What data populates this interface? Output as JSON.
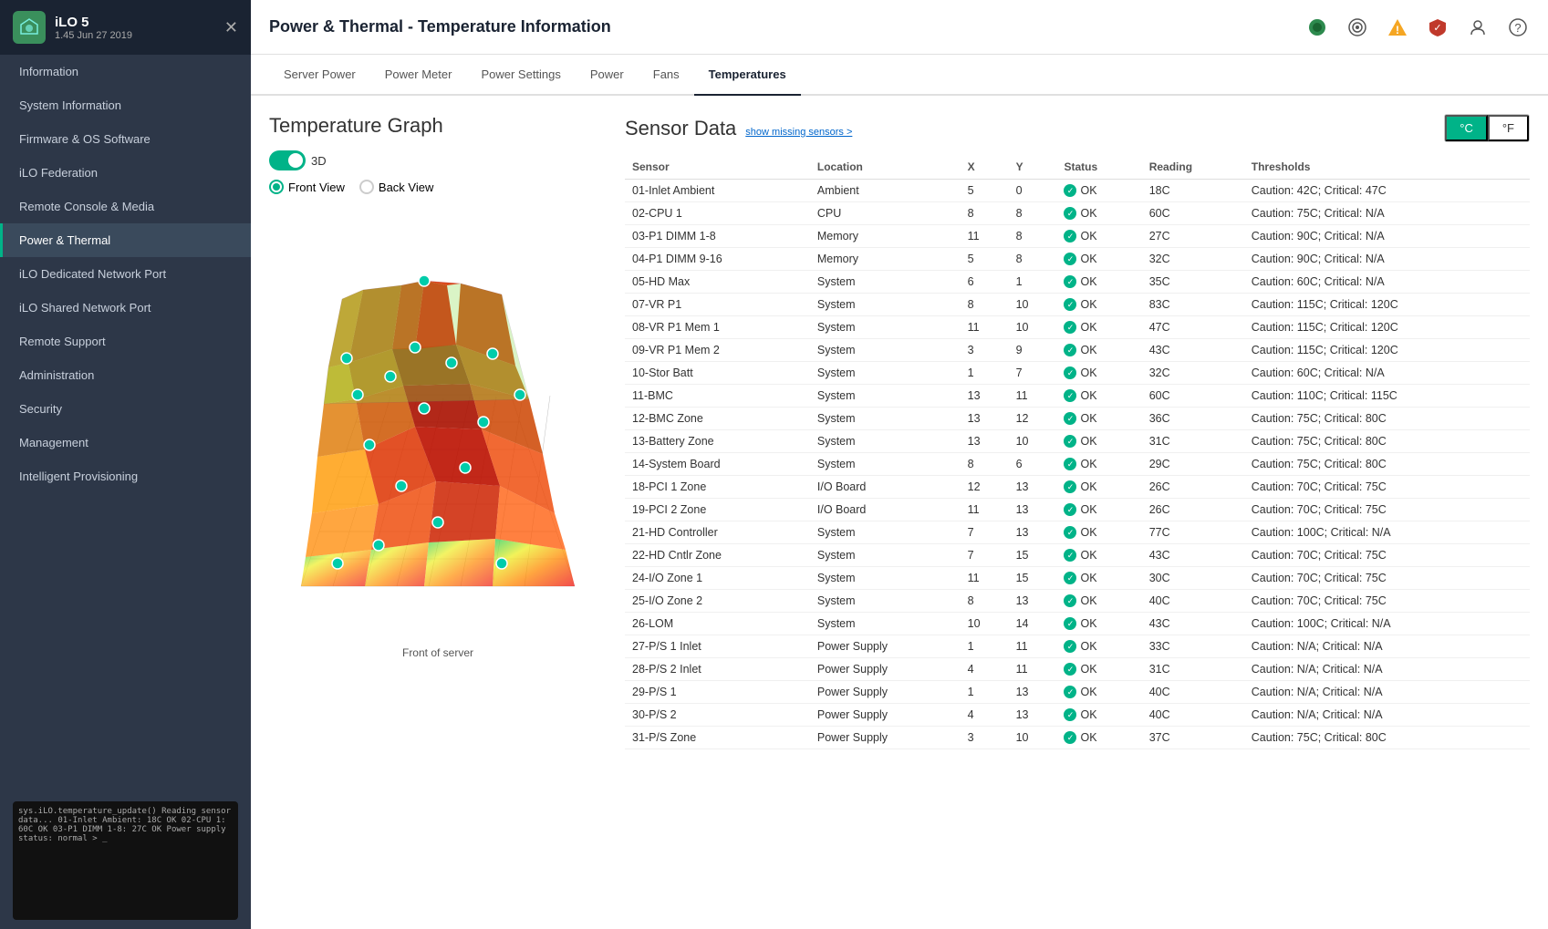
{
  "app": {
    "name": "iLO 5",
    "version": "1.45 Jun 27 2019",
    "logo_text": "iLO"
  },
  "page_title": "Power & Thermal - Temperature Information",
  "topbar_icons": [
    "apple-icon",
    "target-icon",
    "warning-icon",
    "shield-icon",
    "user-icon",
    "help-icon"
  ],
  "sidebar": {
    "items": [
      {
        "label": "Information",
        "id": "information",
        "active": false
      },
      {
        "label": "System Information",
        "id": "system-information",
        "active": false
      },
      {
        "label": "Firmware & OS Software",
        "id": "firmware-os",
        "active": false
      },
      {
        "label": "iLO Federation",
        "id": "ilo-federation",
        "active": false
      },
      {
        "label": "Remote Console & Media",
        "id": "remote-console",
        "active": false
      },
      {
        "label": "Power & Thermal",
        "id": "power-thermal",
        "active": true
      },
      {
        "label": "iLO Dedicated Network Port",
        "id": "ilo-dedicated",
        "active": false
      },
      {
        "label": "iLO Shared Network Port",
        "id": "ilo-shared",
        "active": false
      },
      {
        "label": "Remote Support",
        "id": "remote-support",
        "active": false
      },
      {
        "label": "Administration",
        "id": "administration",
        "active": false
      },
      {
        "label": "Security",
        "id": "security",
        "active": false
      },
      {
        "label": "Management",
        "id": "management",
        "active": false
      },
      {
        "label": "Intelligent Provisioning",
        "id": "intelligent-provisioning",
        "active": false
      }
    ]
  },
  "tabs": [
    {
      "label": "Server Power",
      "active": false
    },
    {
      "label": "Power Meter",
      "active": false
    },
    {
      "label": "Power Settings",
      "active": false
    },
    {
      "label": "Power",
      "active": false
    },
    {
      "label": "Fans",
      "active": false
    },
    {
      "label": "Temperatures",
      "active": true
    }
  ],
  "temp_graph": {
    "title": "Temperature Graph",
    "toggle_3d_label": "3D",
    "toggle_on": true,
    "views": [
      {
        "label": "Front View",
        "selected": true
      },
      {
        "label": "Back View",
        "selected": false
      }
    ],
    "graph_label": "Front of server"
  },
  "sensor_data": {
    "title": "Sensor Data",
    "missing_link": "show missing sensors >",
    "units": [
      "°C",
      "°F"
    ],
    "active_unit": "°C",
    "columns": [
      "Sensor",
      "Location",
      "X",
      "Y",
      "Status",
      "Reading",
      "Thresholds"
    ],
    "rows": [
      {
        "sensor": "01-Inlet Ambient",
        "location": "Ambient",
        "x": "5",
        "y": "0",
        "status": "OK",
        "reading": "18C",
        "thresholds": "Caution: 42C; Critical: 47C"
      },
      {
        "sensor": "02-CPU 1",
        "location": "CPU",
        "x": "8",
        "y": "8",
        "status": "OK",
        "reading": "60C",
        "thresholds": "Caution: 75C; Critical: N/A"
      },
      {
        "sensor": "03-P1 DIMM 1-8",
        "location": "Memory",
        "x": "11",
        "y": "8",
        "status": "OK",
        "reading": "27C",
        "thresholds": "Caution: 90C; Critical: N/A"
      },
      {
        "sensor": "04-P1 DIMM 9-16",
        "location": "Memory",
        "x": "5",
        "y": "8",
        "status": "OK",
        "reading": "32C",
        "thresholds": "Caution: 90C; Critical: N/A"
      },
      {
        "sensor": "05-HD Max",
        "location": "System",
        "x": "6",
        "y": "1",
        "status": "OK",
        "reading": "35C",
        "thresholds": "Caution: 60C; Critical: N/A"
      },
      {
        "sensor": "07-VR P1",
        "location": "System",
        "x": "8",
        "y": "10",
        "status": "OK",
        "reading": "83C",
        "thresholds": "Caution: 115C; Critical: 120C"
      },
      {
        "sensor": "08-VR P1 Mem 1",
        "location": "System",
        "x": "11",
        "y": "10",
        "status": "OK",
        "reading": "47C",
        "thresholds": "Caution: 115C; Critical: 120C"
      },
      {
        "sensor": "09-VR P1 Mem 2",
        "location": "System",
        "x": "3",
        "y": "9",
        "status": "OK",
        "reading": "43C",
        "thresholds": "Caution: 115C; Critical: 120C"
      },
      {
        "sensor": "10-Stor Batt",
        "location": "System",
        "x": "1",
        "y": "7",
        "status": "OK",
        "reading": "32C",
        "thresholds": "Caution: 60C; Critical: N/A"
      },
      {
        "sensor": "11-BMC",
        "location": "System",
        "x": "13",
        "y": "11",
        "status": "OK",
        "reading": "60C",
        "thresholds": "Caution: 110C; Critical: 115C"
      },
      {
        "sensor": "12-BMC Zone",
        "location": "System",
        "x": "13",
        "y": "12",
        "status": "OK",
        "reading": "36C",
        "thresholds": "Caution: 75C; Critical: 80C"
      },
      {
        "sensor": "13-Battery Zone",
        "location": "System",
        "x": "13",
        "y": "10",
        "status": "OK",
        "reading": "31C",
        "thresholds": "Caution: 75C; Critical: 80C"
      },
      {
        "sensor": "14-System Board",
        "location": "System",
        "x": "8",
        "y": "6",
        "status": "OK",
        "reading": "29C",
        "thresholds": "Caution: 75C; Critical: 80C"
      },
      {
        "sensor": "18-PCI 1 Zone",
        "location": "I/O Board",
        "x": "12",
        "y": "13",
        "status": "OK",
        "reading": "26C",
        "thresholds": "Caution: 70C; Critical: 75C"
      },
      {
        "sensor": "19-PCI 2 Zone",
        "location": "I/O Board",
        "x": "11",
        "y": "13",
        "status": "OK",
        "reading": "26C",
        "thresholds": "Caution: 70C; Critical: 75C"
      },
      {
        "sensor": "21-HD Controller",
        "location": "System",
        "x": "7",
        "y": "13",
        "status": "OK",
        "reading": "77C",
        "thresholds": "Caution: 100C; Critical: N/A"
      },
      {
        "sensor": "22-HD Cntlr Zone",
        "location": "System",
        "x": "7",
        "y": "15",
        "status": "OK",
        "reading": "43C",
        "thresholds": "Caution: 70C; Critical: 75C"
      },
      {
        "sensor": "24-I/O Zone 1",
        "location": "System",
        "x": "11",
        "y": "15",
        "status": "OK",
        "reading": "30C",
        "thresholds": "Caution: 70C; Critical: 75C"
      },
      {
        "sensor": "25-I/O Zone 2",
        "location": "System",
        "x": "8",
        "y": "13",
        "status": "OK",
        "reading": "40C",
        "thresholds": "Caution: 70C; Critical: 75C"
      },
      {
        "sensor": "26-LOM",
        "location": "System",
        "x": "10",
        "y": "14",
        "status": "OK",
        "reading": "43C",
        "thresholds": "Caution: 100C; Critical: N/A"
      },
      {
        "sensor": "27-P/S 1 Inlet",
        "location": "Power Supply",
        "x": "1",
        "y": "11",
        "status": "OK",
        "reading": "33C",
        "thresholds": "Caution: N/A; Critical: N/A"
      },
      {
        "sensor": "28-P/S 2 Inlet",
        "location": "Power Supply",
        "x": "4",
        "y": "11",
        "status": "OK",
        "reading": "31C",
        "thresholds": "Caution: N/A; Critical: N/A"
      },
      {
        "sensor": "29-P/S 1",
        "location": "Power Supply",
        "x": "1",
        "y": "13",
        "status": "OK",
        "reading": "40C",
        "thresholds": "Caution: N/A; Critical: N/A"
      },
      {
        "sensor": "30-P/S 2",
        "location": "Power Supply",
        "x": "4",
        "y": "13",
        "status": "OK",
        "reading": "40C",
        "thresholds": "Caution: N/A; Critical: N/A"
      },
      {
        "sensor": "31-P/S Zone",
        "location": "Power Supply",
        "x": "3",
        "y": "10",
        "status": "OK",
        "reading": "37C",
        "thresholds": "Caution: 75C; Critical: 80C"
      }
    ]
  },
  "console_lines": [
    "sys.iLO.temperature_update()",
    "Reading sensor data...",
    "01-Inlet Ambient: 18C OK",
    "02-CPU 1: 60C OK",
    "03-P1 DIMM 1-8: 27C OK",
    "Power supply status: normal",
    "> _"
  ]
}
